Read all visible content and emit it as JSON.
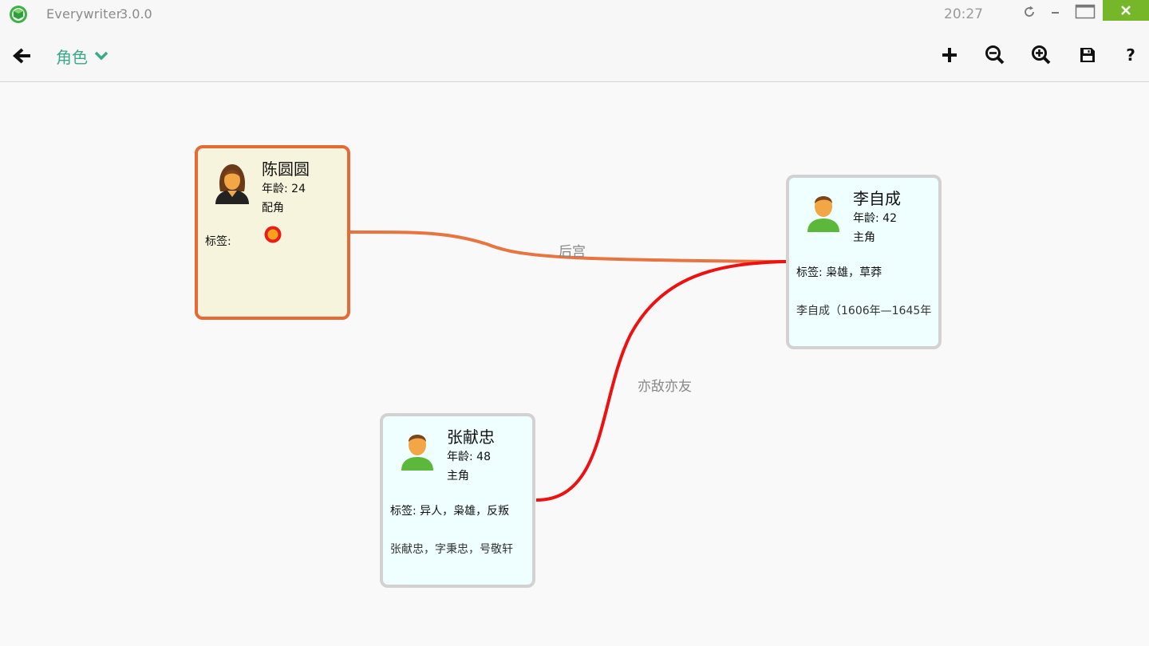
{
  "app": {
    "name": "Everywriter",
    "version": "3.0.0",
    "clock": "20:27"
  },
  "toolbar": {
    "section": "角色",
    "help_label": "?"
  },
  "characters": [
    {
      "name": "陈圆圆",
      "age": "年龄: 24",
      "role": "配角",
      "tags": "标签:",
      "desc": "",
      "gender": "female",
      "border_color": "#e56a36",
      "bg_color": "#f6f4dc"
    },
    {
      "name": "李自成",
      "age": "年龄: 42",
      "role": "主角",
      "tags": "标签: 枭雄，草莽",
      "desc": "李自成（1606年—1645年",
      "gender": "male",
      "border_color": "#d2d2d2",
      "bg_color": "#efffff"
    },
    {
      "name": "张献忠",
      "age": "年龄: 48",
      "role": "主角",
      "tags": "标签: 异人，枭雄，反叛",
      "desc": "张献忠，字秉忠，号敬轩",
      "gender": "male",
      "border_color": "#d2d2d2",
      "bg_color": "#efffff"
    }
  ],
  "relations": [
    {
      "label": "后宫",
      "color": "#e87440"
    },
    {
      "label": "亦敌亦友",
      "color": "#ee1111"
    }
  ],
  "colors": {
    "accent": "#3aaa8a",
    "close_button": "#76b72a"
  }
}
